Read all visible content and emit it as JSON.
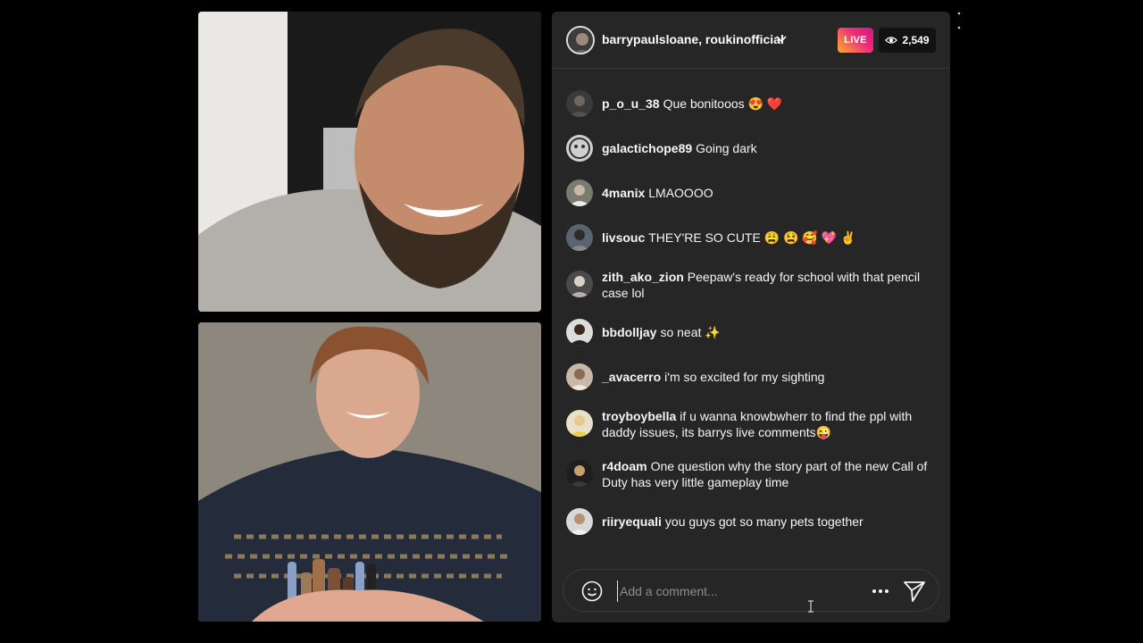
{
  "header": {
    "hosts": "barrypaulsloane, roukinofficial",
    "live_label": "LIVE",
    "viewer_count": "2,549"
  },
  "comments": [
    {
      "user": "p_o_u_38",
      "text": "Que bonitooos 😍 ❤️"
    },
    {
      "user": "galactichope89",
      "text": "Going dark"
    },
    {
      "user": "4manix",
      "text": "LMAOOOO"
    },
    {
      "user": "livsouc",
      "text": "THEY'RE SO CUTE 😩 😫 🥰 💖 ✌️"
    },
    {
      "user": "zith_ako_zion",
      "text": "Peepaw's ready for school with that pencil case lol"
    },
    {
      "user": "bbdolljay",
      "text": "so neat ✨"
    },
    {
      "user": "_avacerro",
      "text": "i'm so excited for my sighting"
    },
    {
      "user": "troyboybella",
      "text": "if u wanna knowbwherr to find the ppl with daddy issues, its barrys live comments😜"
    },
    {
      "user": "r4doam",
      "text": "One question why the story part of the new Call of Duty has very little gameplay time"
    },
    {
      "user": "riiryequali",
      "text": "you guys got so many pets together"
    }
  ],
  "composer": {
    "placeholder": "Add a comment..."
  },
  "icons": {
    "viewers": "eye-icon",
    "emoji": "smiley-icon",
    "more": "more-horizontal-icon",
    "send": "send-icon",
    "dropdown": "chevron-down-icon"
  },
  "colors": {
    "panel_bg": "#262626",
    "live_gradient_start": "#f7b12a",
    "live_gradient_end": "#d1197d",
    "text": "#f5f5f5",
    "placeholder": "#8e8e8e"
  }
}
